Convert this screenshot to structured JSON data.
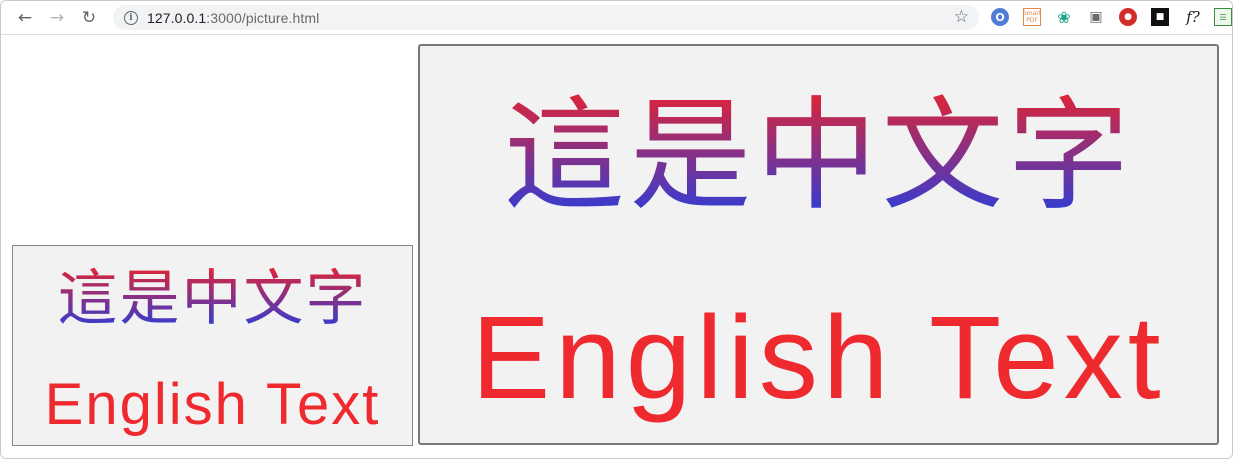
{
  "browser": {
    "url_host": "127.0.0.1",
    "url_rest": ":3000/picture.html",
    "icons": {
      "back": "back-arrow-icon",
      "forward": "forward-arrow-icon",
      "reload": "reload-icon",
      "info": "info-icon",
      "bookmark": "star-icon"
    },
    "extensions": [
      "opera-extension-icon",
      "smart-pdf-extension-icon",
      "bird-extension-icon",
      "camera-extension-icon",
      "lastpass-extension-icon",
      "dark-extension-icon",
      "font-extension-icon",
      "sheet-extension-icon"
    ],
    "ext_labels": {
      "opera": "O",
      "smartpdf_top": "Smart",
      "smartpdf_bottom": "PDF",
      "font": "f?"
    }
  },
  "pictures": {
    "small": {
      "chinese": "這是中文字",
      "english": "English Text"
    },
    "large": {
      "chinese": "這是中文字",
      "english": "English Text"
    }
  },
  "colors": {
    "english_text": "#ee2a2f",
    "chinese_gradient_top": "#e8232d",
    "chinese_gradient_bottom": "#1e3fe6",
    "picture_background": "#f2f2f2"
  }
}
